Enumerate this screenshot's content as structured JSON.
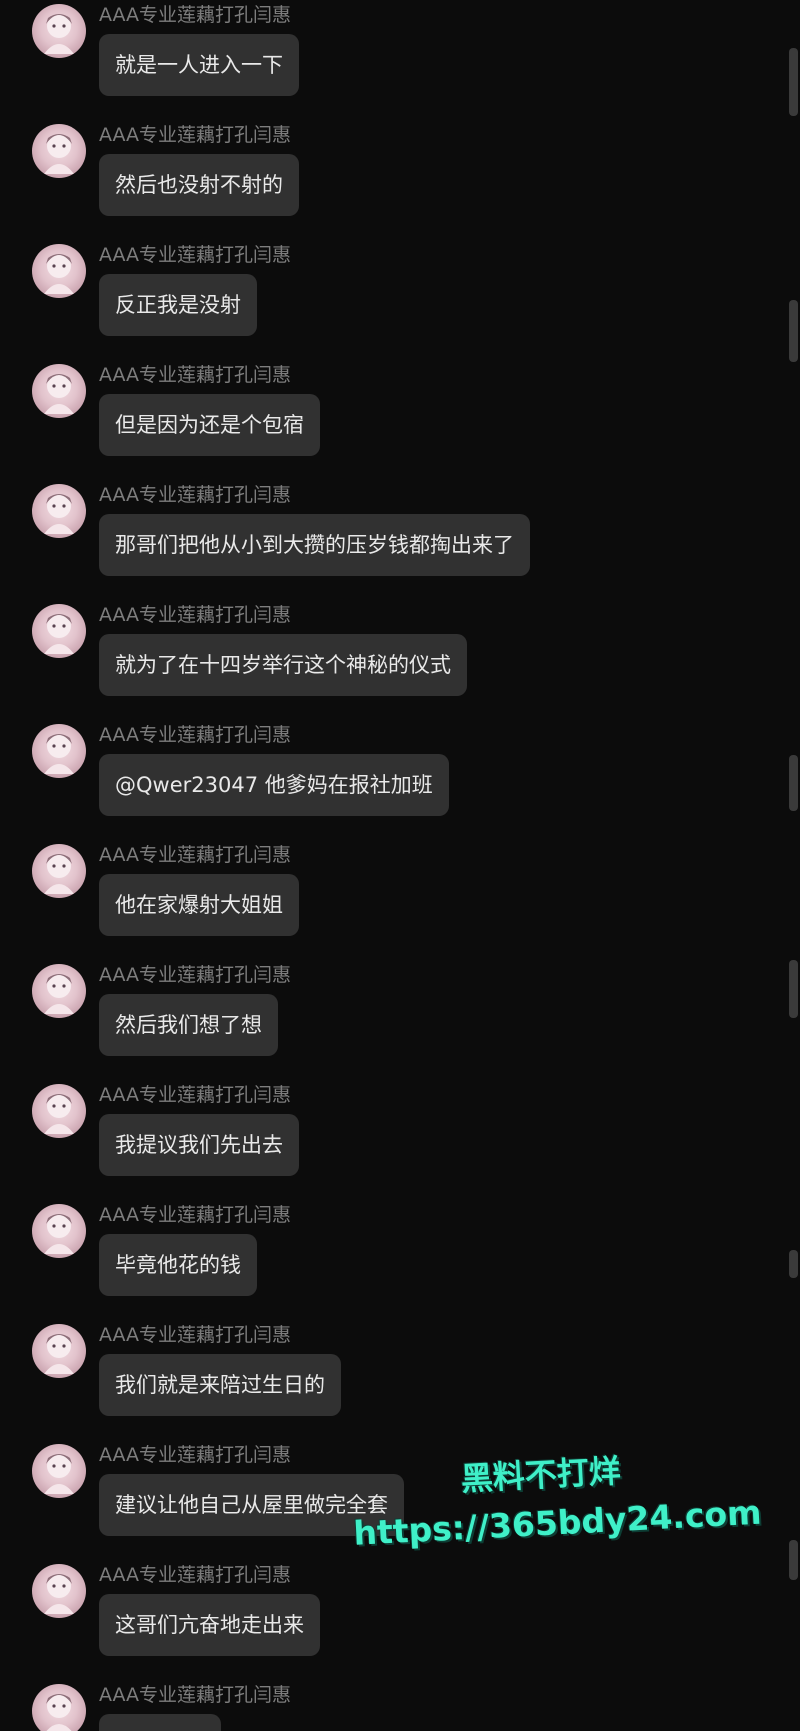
{
  "messages": [
    {
      "sender": "AAA专业莲藕打孔闫惠",
      "text": "就是一人进入一下"
    },
    {
      "sender": "AAA专业莲藕打孔闫惠",
      "text": "然后也没射不射的"
    },
    {
      "sender": "AAA专业莲藕打孔闫惠",
      "text": "反正我是没射"
    },
    {
      "sender": "AAA专业莲藕打孔闫惠",
      "text": "但是因为还是个包宿"
    },
    {
      "sender": "AAA专业莲藕打孔闫惠",
      "text": "那哥们把他从小到大攒的压岁钱都掏出来了"
    },
    {
      "sender": "AAA专业莲藕打孔闫惠",
      "text": "就为了在十四岁举行这个神秘的仪式"
    },
    {
      "sender": "AAA专业莲藕打孔闫惠",
      "text": "@Qwer23047 他爹妈在报社加班"
    },
    {
      "sender": "AAA专业莲藕打孔闫惠",
      "text": "他在家爆射大姐姐"
    },
    {
      "sender": "AAA专业莲藕打孔闫惠",
      "text": "然后我们想了想"
    },
    {
      "sender": "AAA专业莲藕打孔闫惠",
      "text": "我提议我们先出去"
    },
    {
      "sender": "AAA专业莲藕打孔闫惠",
      "text": "毕竟他花的钱"
    },
    {
      "sender": "AAA专业莲藕打孔闫惠",
      "text": "我们就是来陪过生日的"
    },
    {
      "sender": "AAA专业莲藕打孔闫惠",
      "text": "建议让他自己从屋里做完全套"
    },
    {
      "sender": "AAA专业莲藕打孔闫惠",
      "text": "这哥们亢奋地走出来"
    },
    {
      "sender": "AAA专业莲藕打孔闫惠",
      "text": ""
    }
  ],
  "watermark": {
    "line1": "黑料不打烊",
    "line2": "https://365bdy24.com"
  },
  "colors": {
    "background": "#0c0c0c",
    "bubble": "#313131",
    "sender_text": "#7d7d7d",
    "message_text": "#e9e9e9",
    "watermark": "#3ff0c8"
  },
  "icons": {
    "avatar": "user-avatar-icon"
  }
}
